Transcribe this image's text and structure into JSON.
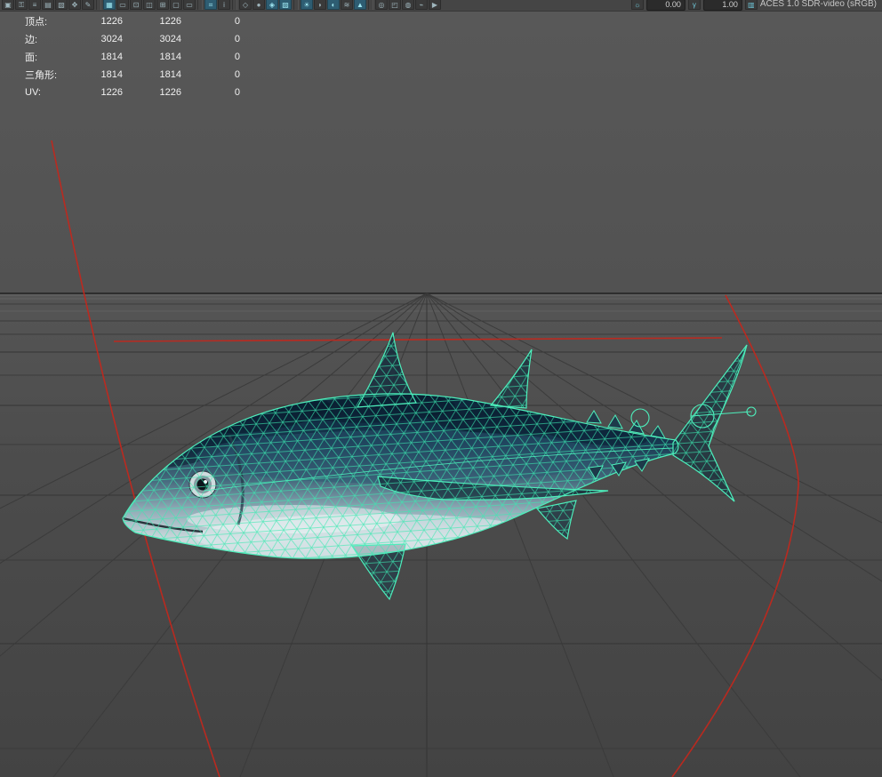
{
  "toolbar": {
    "icons": [
      {
        "name": "select-camera-icon",
        "glyph": "▣",
        "active": false
      },
      {
        "name": "lock-camera-icon",
        "glyph": "⚿",
        "active": false
      },
      {
        "name": "camera-attributes-icon",
        "glyph": "≡",
        "active": false
      },
      {
        "name": "bookmarks-icon",
        "glyph": "▤",
        "active": false
      },
      {
        "name": "image-plane-icon",
        "glyph": "▧",
        "active": false
      },
      {
        "name": "2d-pan-zoom-icon",
        "glyph": "✥",
        "active": false
      },
      {
        "name": "grease-pencil-icon",
        "glyph": "✎",
        "active": false
      },
      {
        "name": "grid-icon",
        "glyph": "▦",
        "active": true
      },
      {
        "name": "film-gate-icon",
        "glyph": "▭",
        "active": false
      },
      {
        "name": "resolution-gate-icon",
        "glyph": "⊡",
        "active": false
      },
      {
        "name": "gate-mask-icon",
        "glyph": "◫",
        "active": false
      },
      {
        "name": "field-chart-icon",
        "glyph": "⊞",
        "active": false
      },
      {
        "name": "safe-action-icon",
        "glyph": "▢",
        "active": false
      },
      {
        "name": "safe-title-icon",
        "glyph": "▭",
        "active": false
      },
      {
        "name": "hud-icon",
        "glyph": "⌗",
        "active": true
      },
      {
        "name": "object-details-icon",
        "glyph": "i",
        "active": false
      },
      {
        "name": "wireframe-icon",
        "glyph": "◇",
        "active": false
      },
      {
        "name": "shaded-icon",
        "glyph": "●",
        "active": false
      },
      {
        "name": "wireframe-on-shaded-icon",
        "glyph": "◈",
        "active": true
      },
      {
        "name": "textured-icon",
        "glyph": "▨",
        "active": true
      },
      {
        "name": "use-all-lights-icon",
        "glyph": "☀",
        "active": true
      },
      {
        "name": "shadows-icon",
        "glyph": "◗",
        "active": false
      },
      {
        "name": "screen-space-ao-icon",
        "glyph": "◐",
        "active": true
      },
      {
        "name": "motion-blur-icon",
        "glyph": "≋",
        "active": false
      },
      {
        "name": "anti-aliasing-icon",
        "glyph": "▲",
        "active": true
      },
      {
        "name": "depth-of-field-icon",
        "glyph": "◎",
        "active": false
      },
      {
        "name": "isolate-select-icon",
        "glyph": "◰",
        "active": false
      },
      {
        "name": "xray-icon",
        "glyph": "◍",
        "active": false
      },
      {
        "name": "joint-xray-icon",
        "glyph": "⌁",
        "active": false
      },
      {
        "name": "playblast-icon",
        "glyph": "▶",
        "active": false
      }
    ],
    "exposure_value": "0.00",
    "gamma_value": "1.00",
    "exposure_icon_glyph": "☼",
    "gamma_icon_glyph": "γ",
    "view_transform_icon_glyph": "▥",
    "view_transform": "ACES 1.0 SDR-video (sRGB)"
  },
  "hud": {
    "rows": [
      {
        "label": "顶点:",
        "c1": "1226",
        "c2": "1226",
        "c3": "0"
      },
      {
        "label": "边:",
        "c1": "3024",
        "c2": "3024",
        "c3": "0"
      },
      {
        "label": "面:",
        "c1": "1814",
        "c2": "1814",
        "c3": "0"
      },
      {
        "label": "三角形:",
        "c1": "1814",
        "c2": "1814",
        "c3": "0"
      },
      {
        "label": "UV:",
        "c1": "1226",
        "c2": "1226",
        "c3": "0"
      }
    ]
  },
  "scene": {
    "model": "fish-wireframe-mesh",
    "wireframe_color": "#3fe8b2",
    "curve_color": "#c0281e",
    "background_color": "#525252"
  }
}
